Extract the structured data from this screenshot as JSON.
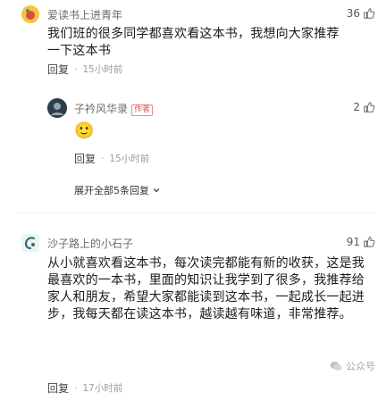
{
  "comments": [
    {
      "username": "爱读书上进青年",
      "likes": "36",
      "content": "我们班的很多同学都喜欢看这本书，我想向大家推荐一下这本书",
      "reply_label": "回复",
      "time": "15小时前"
    }
  ],
  "author_reply": {
    "username": "子衿风华录",
    "author_badge": "作者",
    "likes": "2",
    "emoji": "🙂",
    "reply_label": "回复",
    "time": "15小时前"
  },
  "expand_replies": "展开全部5条回复",
  "second_comment": {
    "username": "沙子路上的小石子",
    "likes": "91",
    "content": "从小就喜欢看这本书，每次读完都能有新的收获，这是我最喜欢的一本书，里面的知识让我学到了很多，我推荐给家人和朋友，希望大家都能读到这本书，一起成长一起进步，我每天都在读这本书，越读越有味道，非常推荐。",
    "reply_label": "回复",
    "time": "17小时前"
  },
  "watermark": "公众号",
  "colors": {
    "username": "#6b6b6b",
    "time": "#9a9a9a",
    "author_badge": "#d9534f"
  },
  "icons": {
    "like": "thumb-up-icon",
    "expand": "chevron-down-icon"
  }
}
